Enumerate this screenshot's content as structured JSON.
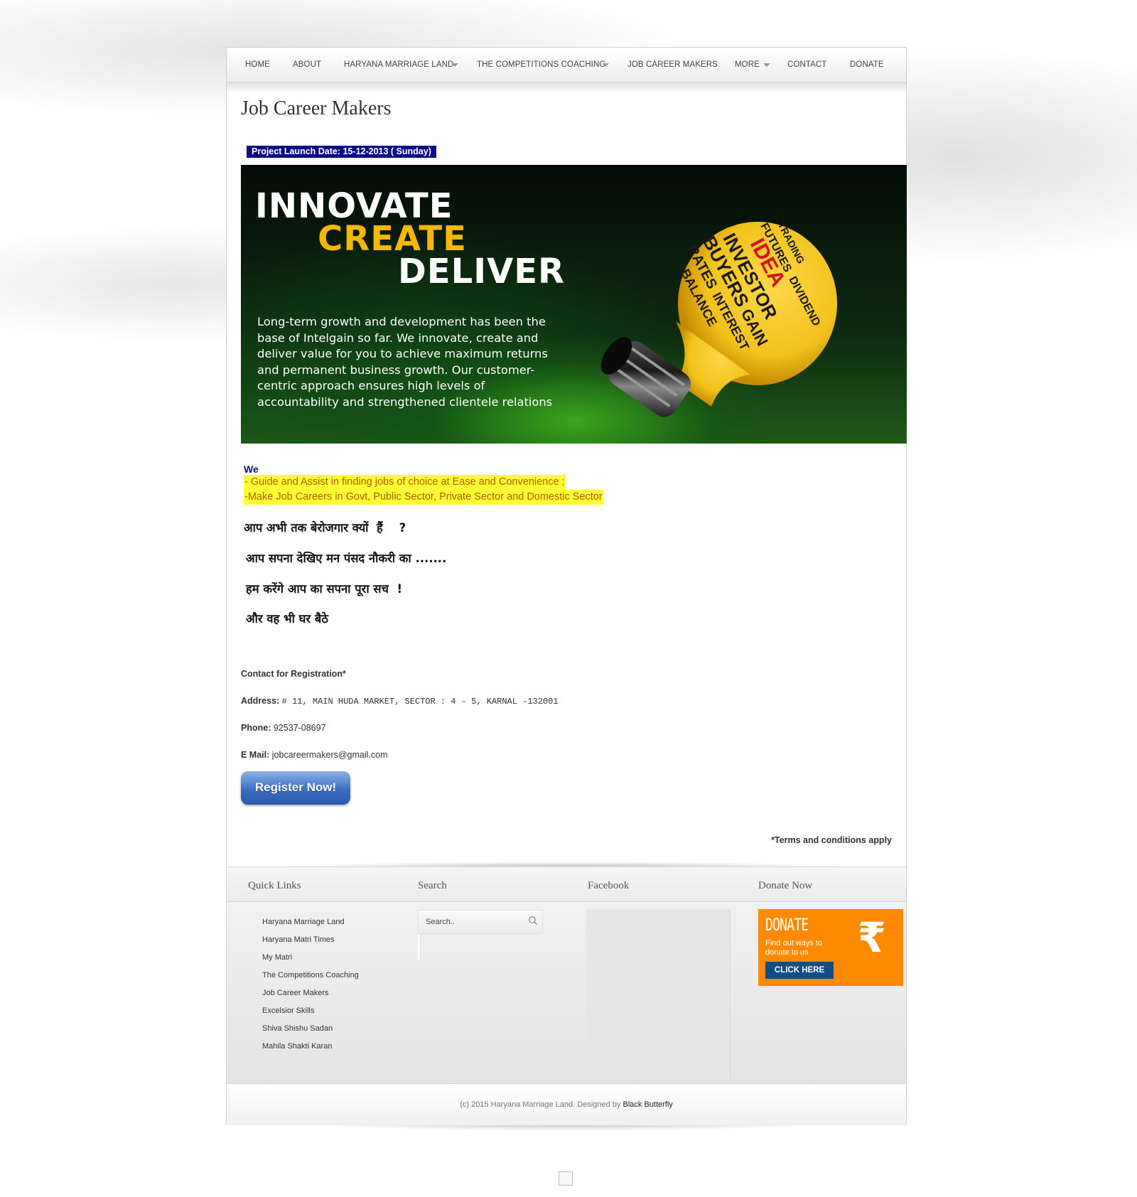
{
  "nav": {
    "items": [
      "HOME",
      "ABOUT",
      "HARYANA MARRIAGE LAND",
      "THE COMPETITIONS COACHING",
      "JOB CAREER MAKERS",
      "MORE",
      "CONTACT",
      "DONATE"
    ]
  },
  "main": {
    "title": "Job Career Makers",
    "launch_label": "Project Launch Date:  15-12-2013  ( Sunday)",
    "banner": {
      "line1": "INNOVATE",
      "line2": "CREATE",
      "line3": "DELIVER",
      "body": "Long-term growth and development has been the base of Intelgain so far. We innovate, create and deliver value for you to achieve maximum returns and permanent business growth. Our customer-centric approach ensures high levels of accountability and strengthened clientele relations",
      "bulb_words": [
        "IDEA",
        "INVESTOR",
        "BUYERS",
        "GAIN",
        "RATES",
        "INTEREST",
        "BALANCE",
        "FUTURES",
        "TRADING",
        "DIVIDEND"
      ],
      "colors": {
        "white": "#ffffff",
        "yellow": "#f5b800",
        "bulb": "#f2c21b",
        "idea": "#d41414"
      }
    },
    "we": {
      "title": "We",
      "line1": "- Guide  and Assist in finding  jobs  of  choice at  Ease  and  Convenience ;",
      "line2": "-Make Job Careers   in  Govt,  Public Sector,  Private Sector and Domestic Sector"
    },
    "hindi": [
      "आप अभी तक बेरोजगार क्यों  हैं    ?",
      "आप सपना देखिए मन पंसद नौकरी का .......",
      "हम करेंगे आप का सपना पूरा सच  !",
      "और वह भी घर बैठे"
    ],
    "contact": {
      "heading": "Contact for Registration*",
      "address_label": "Address:",
      "address_value": "#  11,  MAIN  HUDA  MARKET, SECTOR :  4 – 5,  KARNAL -132001",
      "phone_label": "Phone:",
      "phone_value": "92537-08697",
      "email_label": "E Mail:",
      "email_value": "jobcareermakers@gmail.com"
    },
    "register_label": "Register Now!",
    "terms": "*Terms and conditions apply"
  },
  "footer": {
    "headings": {
      "quick_links": "Quick Links",
      "search": "Search",
      "facebook": "Facebook",
      "donate": "Donate Now"
    },
    "quick_links": [
      "Haryana Marriage Land",
      "Haryana Matri Times",
      "My Matri",
      "The Competitions Coaching",
      "Job Career Makers",
      "Excelsior Skills",
      "Shiva Shishu Sadan",
      "Mahila Shakti Karan"
    ],
    "search_placeholder": "Search..",
    "donate_box": {
      "title": "DONATE",
      "subtitle": "Find out ways to donate to us",
      "button": "CLICK HERE",
      "symbol": "₹",
      "color": "#ff8a00"
    },
    "copyright_prefix": "(c) 2015 Haryana Marriage Land. Designed by ",
    "copyright_link": "Black Butterfly"
  }
}
